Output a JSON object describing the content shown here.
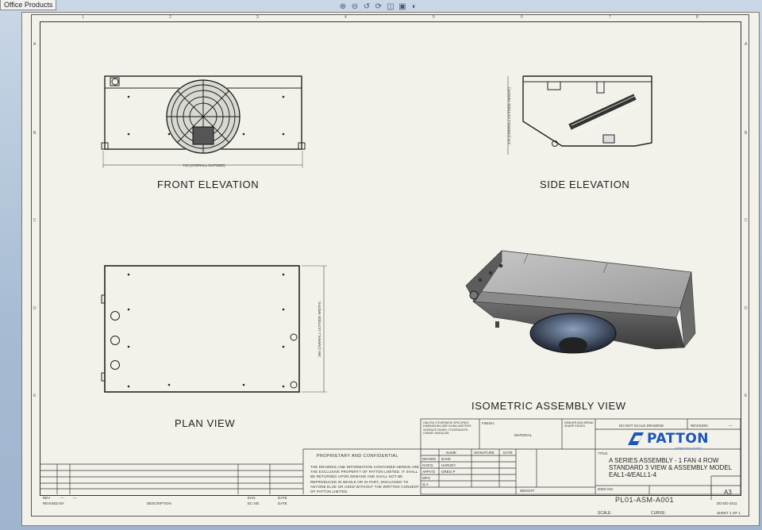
{
  "app": {
    "office_tab": "Office Products"
  },
  "toolbar": {
    "icons": [
      "zoom-to-fit-icon",
      "zoom-area-icon",
      "previous-view-icon",
      "rotate-icon",
      "section-view-icon",
      "display-style-icon",
      "view-settings-icon"
    ],
    "glyphs": [
      "⊕",
      "⊖",
      "↺",
      "⟳",
      "◫",
      "▣",
      "◐"
    ]
  },
  "zones": {
    "top": [
      "1",
      "2",
      "3",
      "4",
      "5",
      "6",
      "7",
      "8"
    ],
    "side": [
      "A",
      "B",
      "C",
      "D",
      "E"
    ]
  },
  "views": {
    "front": {
      "title": "FRONT ELEVATION",
      "dim": "710 (OVERALL OUTSIDE)"
    },
    "side": {
      "title": "SIDE ELEVATION",
      "dim": "275 (OVERALL OUTSIDE HEIGHT)"
    },
    "plan": {
      "title": "PLAN VIEW",
      "dim": "365 (OVERALL OUTSIDE WIDTH)"
    },
    "iso": {
      "title": "ISOMETRIC ASSEMBLY VIEW"
    }
  },
  "title_block": {
    "notes": "UNLESS OTHERWISE SPECIFIED: DIMENSIONS ARE IN MILLIMETERS SURFACE FINISH: TOLERANCES: LINEAR: ANGULAR:",
    "finish_label": "FINISH:",
    "material_label": "MATERIAL",
    "deburr": "DEBURR AND BREAK SHARP EDGES",
    "do_not_scale": "DO NOT SCALE DRAWING",
    "revision_label": "REVISION:",
    "revision_value": "—",
    "proprietary_heading": "PROPRIETARY AND CONFIDENTIAL",
    "proprietary_text": "THE DRAWING AND INFORMATION CONTAINED HEREIN ARE THE EXCLUSIVE PROPERTY OF PATTON LIMITED. IT SHALL BE RETURNED UPON DEMAND AND SHALL NOT BE REPRODUCED IN WHOLE OR IN PART, DISCLOSED TO ANYONE ELSE OR USED WITHOUT THE WRITTEN CONSENT OF PATTON LIMITED.",
    "table_headers": [
      "NAME",
      "SIGNATURE",
      "DATE"
    ],
    "rows": [
      {
        "role": "DRAWN",
        "name": "DAVE"
      },
      {
        "role": "CHK'D",
        "name": "HARVEY"
      },
      {
        "role": "APPV'D",
        "name": "GREG P"
      },
      {
        "role": "MFG",
        "name": ""
      },
      {
        "role": "Q.A",
        "name": ""
      }
    ],
    "weight_label": "WEIGHT:",
    "title_label": "TITLE:",
    "title_lines": [
      "A SERIES ASSEMBLY - 1 FAN 4 ROW",
      "STANDARD 3 VIEW & ASSEMBLY MODEL",
      "EAL1-4/EALL1-4"
    ],
    "dwg_no_label": "DWG NO.",
    "dwg_no": "PL01-ASM-A001",
    "size": "A3",
    "date": "DD-DD-2011",
    "scale_label": "SCALE:",
    "curve_label": "CURVE:",
    "sheet_label": "SHEET 1 OF 1",
    "logo": "PATTON",
    "logo_tag": "refrigeration limited",
    "rev_table": {
      "headers": [
        "REV",
        "DESCRIPTION",
        "ECN",
        "DATE"
      ],
      "row": [
        "DATE",
        "—",
        "—",
        "—"
      ],
      "extra": [
        "REVISED BY",
        "EC NO.",
        "DATE"
      ]
    }
  }
}
